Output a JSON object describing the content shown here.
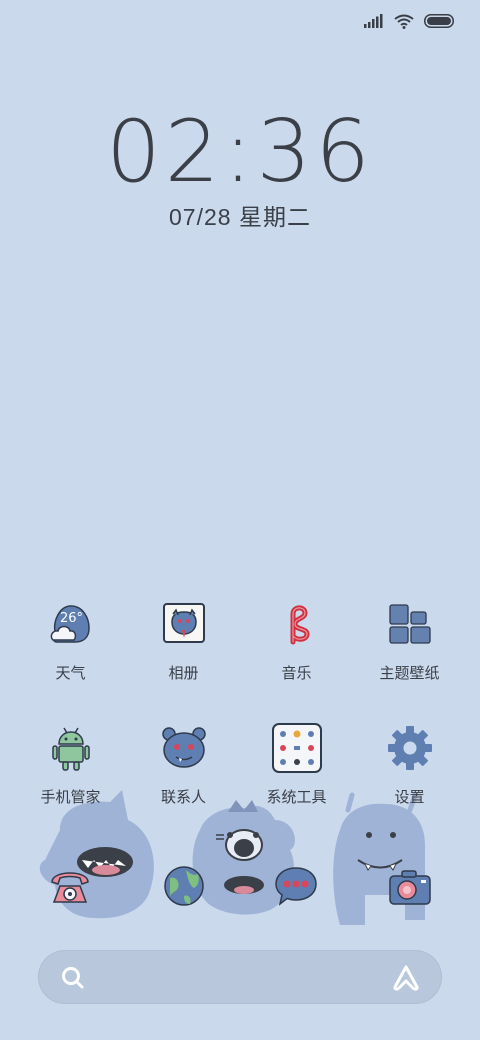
{
  "clock": {
    "time": "02:36",
    "date": "07/28 星期二"
  },
  "status_bar": {
    "icons": [
      "signal-icon",
      "wifi-icon",
      "battery-icon"
    ]
  },
  "apps_row1": [
    {
      "label": "天气",
      "icon": "weather-icon",
      "temp": "26°"
    },
    {
      "label": "相册",
      "icon": "gallery-icon"
    },
    {
      "label": "音乐",
      "icon": "music-icon"
    },
    {
      "label": "主题壁纸",
      "icon": "themes-icon"
    }
  ],
  "apps_row2": [
    {
      "label": "手机管家",
      "icon": "security-icon"
    },
    {
      "label": "联系人",
      "icon": "contacts-icon"
    },
    {
      "label": "系统工具",
      "icon": "tools-folder-icon"
    },
    {
      "label": "设置",
      "icon": "settings-icon"
    }
  ],
  "dock": [
    {
      "icon": "phone-icon"
    },
    {
      "icon": "browser-icon"
    },
    {
      "icon": "messages-icon"
    },
    {
      "icon": "camera-icon"
    }
  ],
  "search_bar": {
    "left_icon": "search-icon",
    "right_icon": "assistant-icon"
  },
  "colors": {
    "background": "#cbd9ec",
    "text": "#3a3f47",
    "accent": "#6f8fbf"
  }
}
